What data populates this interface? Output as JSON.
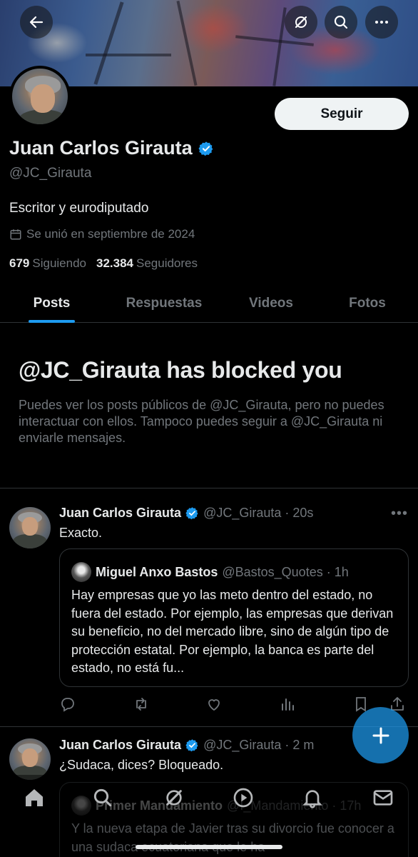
{
  "profile": {
    "name": "Juan Carlos Girauta",
    "handle": "@JC_Girauta",
    "bio": "Escritor y eurodiputado",
    "joined": "Se unió en septiembre de 2024",
    "following_count": "679",
    "following_label": "Siguiendo",
    "followers_count": "32.384",
    "followers_label": "Seguidores",
    "follow_label": "Seguir"
  },
  "top_bar": {
    "back_icon": "back-arrow-icon",
    "grok_icon": "grok-icon",
    "search_icon": "search-icon",
    "more_icon": "more-icon"
  },
  "tabs": [
    {
      "label": "Posts",
      "active": true
    },
    {
      "label": "Respuestas",
      "active": false
    },
    {
      "label": "Videos",
      "active": false
    },
    {
      "label": "Fotos",
      "active": false
    }
  ],
  "blocked": {
    "title": "@JC_Girauta has blocked you",
    "text": "Puedes ver los posts públicos de @JC_Girauta, pero no puedes interactuar con ellos. Tampoco puedes seguir a @JC_Girauta ni enviarle mensajes."
  },
  "tweets": [
    {
      "name": "Juan Carlos Girauta",
      "meta": "@JC_Girauta · 20s",
      "text": "Exacto.",
      "quote": {
        "name": "Miguel Anxo Bastos",
        "meta": "@Bastos_Quotes · 1h",
        "text": "Hay empresas que yo las meto dentro del estado, no fuera del estado. Por ejemplo, las empresas que derivan su beneficio, no del mercado libre, sino de algún tipo de protección estatal. Por ejemplo, la banca es parte del estado, no está fu..."
      }
    },
    {
      "name": "Juan Carlos Girauta",
      "meta": "@JC_Girauta · 2 m",
      "text": "¿Sudaca, dices? Bloqueado.",
      "quote": {
        "name": "Primer Mandamiento",
        "meta": "@I_Mandamiento · 17h",
        "text": "Y la nueva etapa de Javier tras su divorcio fue conocer a una sudaca ecuatoriana que le ha"
      }
    }
  ],
  "colors": {
    "background": "#000000",
    "accent": "#1d9bf0",
    "text": "#e7e9ea",
    "muted": "#71767b",
    "border": "#2f3336"
  },
  "fab_icon": "plus-icon",
  "bottom_nav": [
    "home-icon",
    "search-icon",
    "grok-icon",
    "video-icon",
    "notifications-icon",
    "messages-icon"
  ]
}
